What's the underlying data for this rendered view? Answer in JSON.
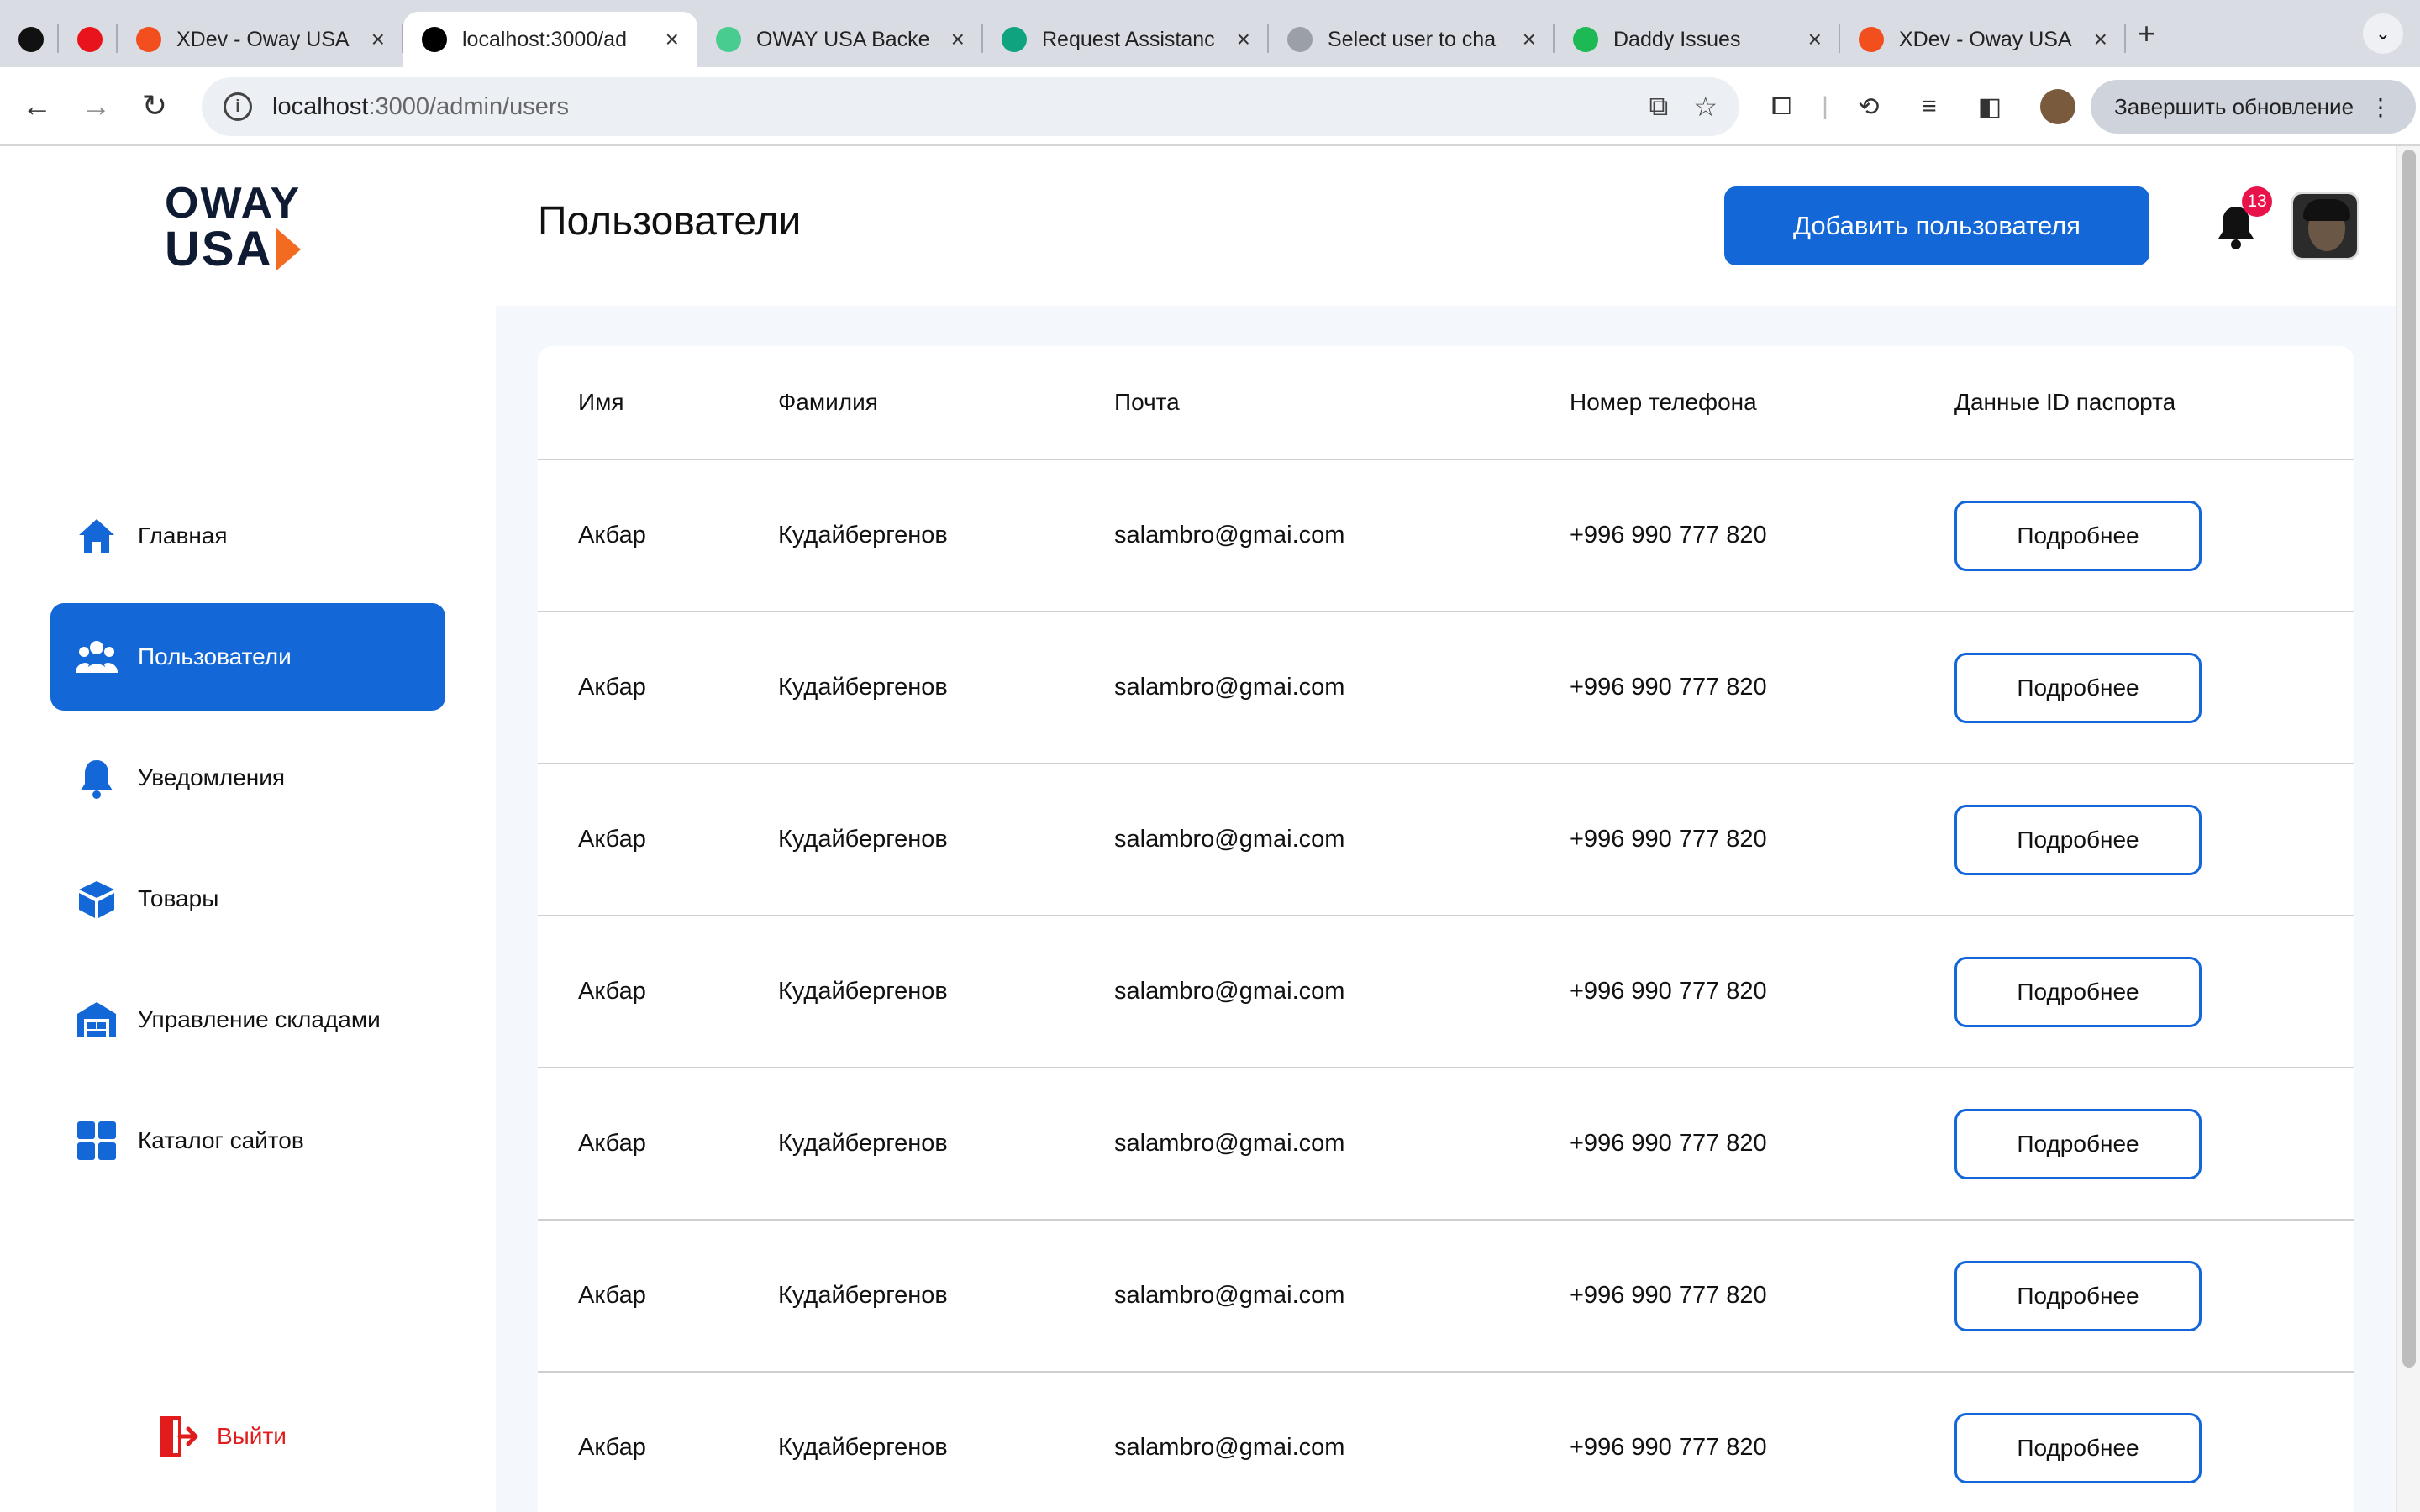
{
  "browser": {
    "tabs": [
      {
        "title": "",
        "icon": "k-logo-icon",
        "color": "#111111"
      },
      {
        "title": "",
        "icon": "red-m-logo-icon",
        "color": "#e8131b"
      },
      {
        "title": "XDev - Oway USA",
        "icon": "figma-icon",
        "color": "#f24e1e"
      },
      {
        "title": "localhost:3000/ad",
        "icon": "nextjs-icon",
        "color": "#000000",
        "active": true
      },
      {
        "title": "OWAY USA Backe",
        "icon": "swagger-icon",
        "color": "#49cc90"
      },
      {
        "title": "Request Assistanc",
        "icon": "chatgpt-icon",
        "color": "#10a37f"
      },
      {
        "title": "Select user to cha",
        "icon": "globe-icon",
        "color": "#9aa0a6"
      },
      {
        "title": "Daddy Issues",
        "icon": "spotify-icon",
        "color": "#1db954"
      },
      {
        "title": "XDev - Oway USA",
        "icon": "figma-icon",
        "color": "#f24e1e"
      }
    ],
    "url_host": "localhost",
    "url_path": ":3000/admin/users",
    "update_button": "Завершить обновление"
  },
  "brand": {
    "line1": "OWAY",
    "line2": "USA",
    "accent": "#f36b21",
    "dark": "#0e1b33"
  },
  "sidebar": {
    "items": [
      {
        "label": "Главная",
        "icon": "home-icon"
      },
      {
        "label": "Пользователи",
        "icon": "users-icon",
        "active": true
      },
      {
        "label": "Уведомления",
        "icon": "bell-icon"
      },
      {
        "label": "Товары",
        "icon": "box-icon"
      },
      {
        "label": "Управление складами",
        "icon": "warehouse-icon"
      },
      {
        "label": "Каталог сайтов",
        "icon": "grid-icon"
      }
    ],
    "logout": "Выйти"
  },
  "header": {
    "title": "Пользователи",
    "add_button": "Добавить пользователя",
    "notifications_count": "13"
  },
  "table": {
    "columns": [
      "Имя",
      "Фамилия",
      "Почта",
      "Номер телефона",
      "Данные ID паспорта"
    ],
    "more_label": "Подробнее",
    "rows": [
      {
        "first": "Акбар",
        "last": "Кудайбергенов",
        "email": "salambro@gmai.com",
        "phone": "+996 990 777 820"
      },
      {
        "first": "Акбар",
        "last": "Кудайбергенов",
        "email": "salambro@gmai.com",
        "phone": "+996 990 777 820"
      },
      {
        "first": "Акбар",
        "last": "Кудайбергенов",
        "email": "salambro@gmai.com",
        "phone": "+996 990 777 820"
      },
      {
        "first": "Акбар",
        "last": "Кудайбергенов",
        "email": "salambro@gmai.com",
        "phone": "+996 990 777 820"
      },
      {
        "first": "Акбар",
        "last": "Кудайбергенов",
        "email": "salambro@gmai.com",
        "phone": "+996 990 777 820"
      },
      {
        "first": "Акбар",
        "last": "Кудайбергенов",
        "email": "salambro@gmai.com",
        "phone": "+996 990 777 820"
      },
      {
        "first": "Акбар",
        "last": "Кудайбергенов",
        "email": "salambro@gmai.com",
        "phone": "+996 990 777 820"
      }
    ]
  },
  "colors": {
    "primary": "#1467d6",
    "danger": "#e21c1c",
    "badge": "#e8134a"
  }
}
